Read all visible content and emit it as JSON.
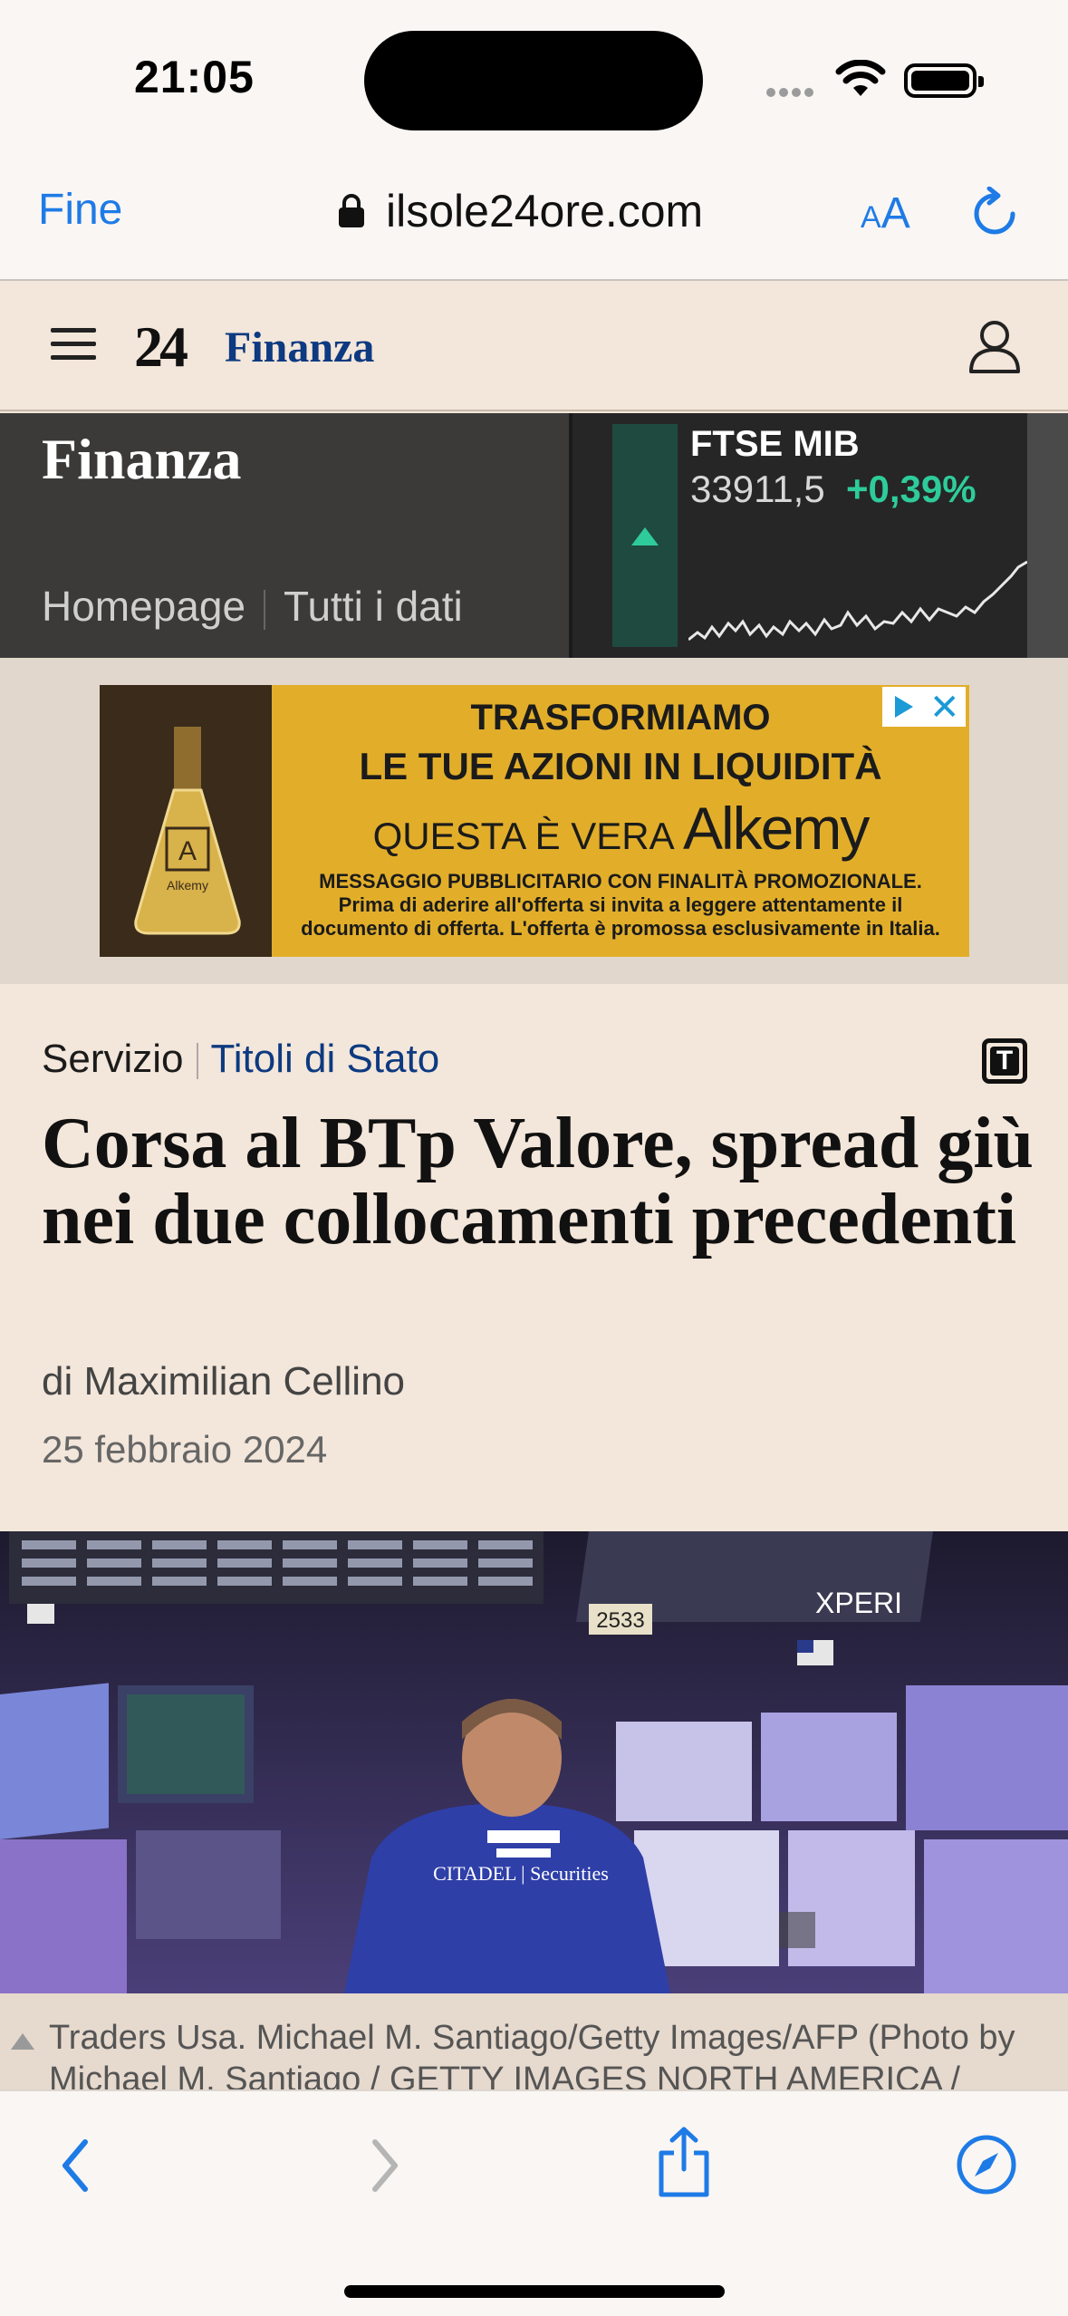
{
  "status_bar": {
    "time": "21:05"
  },
  "browser": {
    "done_label": "Fine",
    "url": "ilsole24ore.com",
    "text_size_small": "A",
    "text_size_large": "A"
  },
  "site": {
    "logo": "24",
    "section": "Finanza"
  },
  "finance": {
    "title": "Finanza",
    "links": [
      "Homepage",
      "Tutti i dati"
    ],
    "ticker": {
      "name": "FTSE MIB",
      "value": "33911,5",
      "change": "+0,39%"
    }
  },
  "ad": {
    "line1": "TRASFORMIAMO",
    "line2": "LE TUE AZIONI IN LIQUIDITÀ",
    "line3": "QUESTA È VERA",
    "brand": "Alkemy",
    "flask_letter": "A",
    "flask_brand": "Alkemy",
    "disclaimer1": "MESSAGGIO PUBBLICITARIO CON FINALITÀ PROMOZIONALE.",
    "disclaimer2": "Prima di aderire all'offerta si invita a leggere attentamente il",
    "disclaimer3": "documento di offerta. L'offerta è promossa esclusivamente in Italia."
  },
  "article": {
    "kicker_type": "Servizio",
    "kicker_topic": "Titoli di Stato",
    "headline": "Corsa al BTp Valore, spread giù nei due collocamenti precedenti",
    "byline": "di Maximilian Cellino",
    "date": "25 febbraio 2024",
    "caption": "Traders Usa. Michael M. Santiago/Getty Images/AFP (Photo by Michael M. Santiago / GETTY IMAGES NORTH AMERICA /"
  },
  "photo": {
    "jacket_text": "CITADEL | Securities",
    "post_number": "2533",
    "sign": "XPERI"
  },
  "colors": {
    "accent_blue": "#1e7be6",
    "brand_navy": "#0d3a80",
    "positive_green": "#2ecc9a",
    "page_bg": "#f3e6da"
  }
}
